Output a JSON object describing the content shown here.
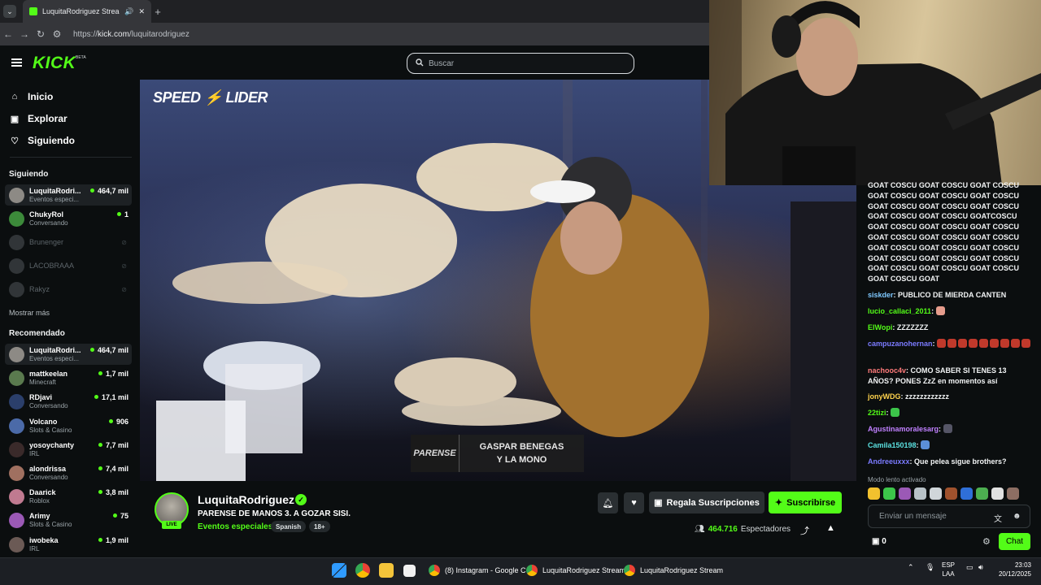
{
  "browser": {
    "tab_title": "LuquitaRodriguez Stream",
    "url_prefix": "https://",
    "url_host": "kick.com",
    "url_path": "/luquitarodriguez"
  },
  "header": {
    "logo": "KICK",
    "logo_badge": "BETA",
    "search_placeholder": "Buscar"
  },
  "sidebar": {
    "nav": [
      {
        "label": "Inicio",
        "icon": "home-icon"
      },
      {
        "label": "Explorar",
        "icon": "compass-icon"
      },
      {
        "label": "Siguiendo",
        "icon": "heart-icon"
      }
    ],
    "following_title": "Siguiendo",
    "following": [
      {
        "name": "LuquitaRodri...",
        "category": "Eventos especi...",
        "viewers": "464,7 mil",
        "live": true,
        "color": "#8d8a85"
      },
      {
        "name": "ChukyRol",
        "category": "Conversando",
        "viewers": "1",
        "live": true,
        "color": "#3c8a3a"
      },
      {
        "name": "Brunenger",
        "live": false,
        "color": "#6b7175"
      },
      {
        "name": "LACOBRAAA",
        "live": false,
        "color": "#6b7175"
      },
      {
        "name": "Rakyz",
        "live": false,
        "color": "#6b7175"
      }
    ],
    "show_more": "Mostrar más",
    "recommended_title": "Recomendado",
    "recommended": [
      {
        "name": "LuquitaRodri...",
        "category": "Eventos especi...",
        "viewers": "464,7 mil",
        "color": "#8d8a85"
      },
      {
        "name": "mattkeelan",
        "category": "Minecraft",
        "viewers": "1,7 mil",
        "color": "#5a7a4e"
      },
      {
        "name": "RDjavi",
        "category": "Conversando",
        "viewers": "17,1 mil",
        "color": "#2b3f6b"
      },
      {
        "name": "Volcano",
        "category": "Slots & Casino",
        "viewers": "906",
        "color": "#4b6aa8"
      },
      {
        "name": "yosoychanty",
        "category": "IRL",
        "viewers": "7,7 mil",
        "color": "#3a2a2a"
      },
      {
        "name": "alondrissa",
        "category": "Conversando",
        "viewers": "7,4 mil",
        "color": "#a07060"
      },
      {
        "name": "Daarick",
        "category": "Roblox",
        "viewers": "3,8 mil",
        "color": "#c07a90"
      },
      {
        "name": "Arimy",
        "category": "Slots & Casino",
        "viewers": "75",
        "color": "#9b59b6"
      },
      {
        "name": "iwobeka",
        "category": "IRL",
        "viewers": "1,9 mil",
        "color": "#6b5a55"
      }
    ]
  },
  "video": {
    "overlay_left": "SPEED",
    "overlay_right": "LIDER",
    "lower_third_logo": "PARENSE",
    "lower_third_line1": "GASPAR BENEGAS",
    "lower_third_line2": "Y LA MONO"
  },
  "stream": {
    "channel": "LuquitaRodriguez",
    "live_badge": "LIVE",
    "title": "PARENSE DE MANOS 3. A GOZAR SISI.",
    "category": "Eventos especiales",
    "tags": [
      "Spanish",
      "18+"
    ],
    "gift_label": "Regala Suscripciones",
    "subscribe_label": "Suscribirse",
    "viewers_count": "464.716",
    "viewers_label": "Espectadores"
  },
  "chat": {
    "spam_lines": [
      "GOAT COSCU GOAT COSCU GOAT COSCU",
      "GOAT COSCU GOAT COSCU GOAT COSCU",
      "GOAT COSCU GOAT COSCU GOAT COSCU",
      "GOAT COSCU GOAT COSCU GOATCOSCU",
      "GOAT COSCU GOAT COSCU GOAT COSCU",
      "GOAT COSCU GOAT COSCU GOAT COSCU",
      "GOAT COSCU GOAT COSCU GOAT COSCU",
      "GOAT COSCU GOAT COSCU GOAT COSCU",
      "GOAT COSCU GOAT COSCU GOAT COSCU",
      "GOAT COSCU GOAT"
    ],
    "messages": [
      {
        "user": "siskder",
        "color": "#7ec8ff",
        "text": "PUBLICO DE MIERDA CANTEN"
      },
      {
        "user": "lucio_callaci_2011",
        "color": "#53fc18",
        "text": ""
      },
      {
        "user": "ElWopi",
        "color": "#53fc18",
        "text": "ZZZZZZZ"
      },
      {
        "user": "campuzanohernan",
        "color": "#7b7bff",
        "text": ""
      },
      {
        "user": "nachooc4v",
        "color": "#ff7b7b",
        "text": "COMO SABER SI TENES 13 AÑOS? PONES ZzZ en momentos así"
      },
      {
        "user": "jonyWDG",
        "color": "#ffd34d",
        "text": "zzzzzzzzzzzz"
      },
      {
        "user": "22tizi",
        "color": "#53fc18",
        "text": ""
      },
      {
        "user": "Agustinamoralesarg",
        "color": "#c080ff",
        "text": ""
      },
      {
        "user": "Camila150198",
        "color": "#5be0e0",
        "text": ""
      },
      {
        "user": "Andreeuxxx",
        "color": "#7b7bff",
        "text": "Que pelea sigue brothers?"
      }
    ],
    "slow_mode": "Modo lento activado",
    "input_placeholder": "Enviar un mensaje",
    "points": "0",
    "chat_button": "Chat"
  },
  "taskbar": {
    "apps": [
      {
        "label": "(8) Instagram - Google C"
      },
      {
        "label": "LuquitaRodriguez Stream"
      },
      {
        "label": "LuquitaRodriguez Stream"
      }
    ],
    "lang_line1": "ESP",
    "lang_line2": "LAA",
    "time": "23:03",
    "date": "20/12/2025"
  }
}
